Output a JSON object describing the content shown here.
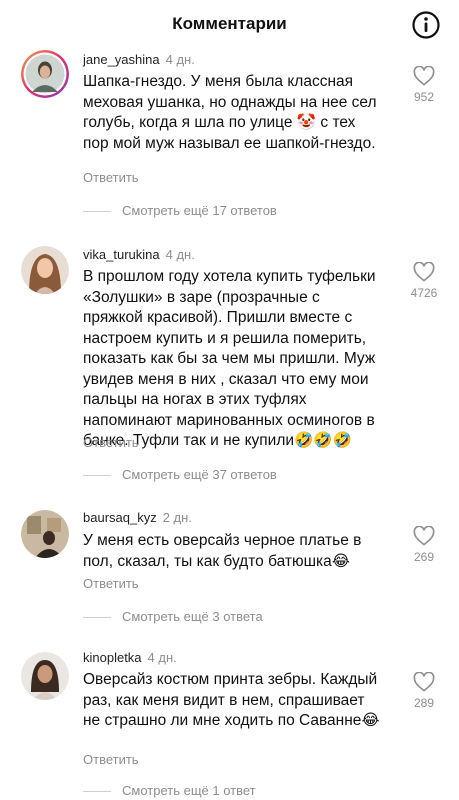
{
  "header": {
    "title": "Комментарии",
    "info_icon": "info-circle-icon"
  },
  "comments": [
    {
      "username": "jane_yashina",
      "time": "4 дн.",
      "text": "Шапка-гнездо. У меня была классная меховая ушанка, но однажды на нее сел голубь, когда я шла по улице 🤡 с тех пор мой муж называл ее шапкой-гнездо.",
      "reply_label": "Ответить",
      "likes": "952",
      "more_replies": "Смотреть ещё 17 ответов"
    },
    {
      "username": "vika_turukina",
      "time": "4 дн.",
      "text": "В прошлом году хотела купить туфельки «Золушки» в заре (прозрачные с пряжкой красивой). Пришли вместе с настроем купить и я решила померить, показать как бы за чем мы пришли. Муж увидев меня в них , сказал что ему мои пальцы на ногах в этих туфлях напоминают маринованных осминогов в банке. Туфли так и не купили🤣🤣🤣",
      "reply_label": "Ответить",
      "likes": "4726",
      "more_replies": "Смотреть ещё 37 ответов"
    },
    {
      "username": "baursaq_kyz",
      "time": "2 дн.",
      "text": "У меня есть оверсайз черное платье в пол, сказал, ты как будто батюшка😂",
      "reply_label": "Ответить",
      "likes": "269",
      "more_replies": "Смотреть ещё 3 ответа"
    },
    {
      "username": "kinopletka",
      "time": "4 дн.",
      "text": "Оверсайз костюм принта зебры. Каждый раз, как меня видит в нем, спрашивает не страшно ли мне ходить по Саванне😂",
      "reply_label": "Ответить",
      "likes": "289",
      "more_replies": "Смотреть ещё 1 ответ"
    }
  ],
  "icons": {
    "like": "heart-outline-icon"
  },
  "colors": {
    "secondary_text": "#8e8e8e",
    "primary_text": "#111111",
    "background": "#ffffff"
  }
}
